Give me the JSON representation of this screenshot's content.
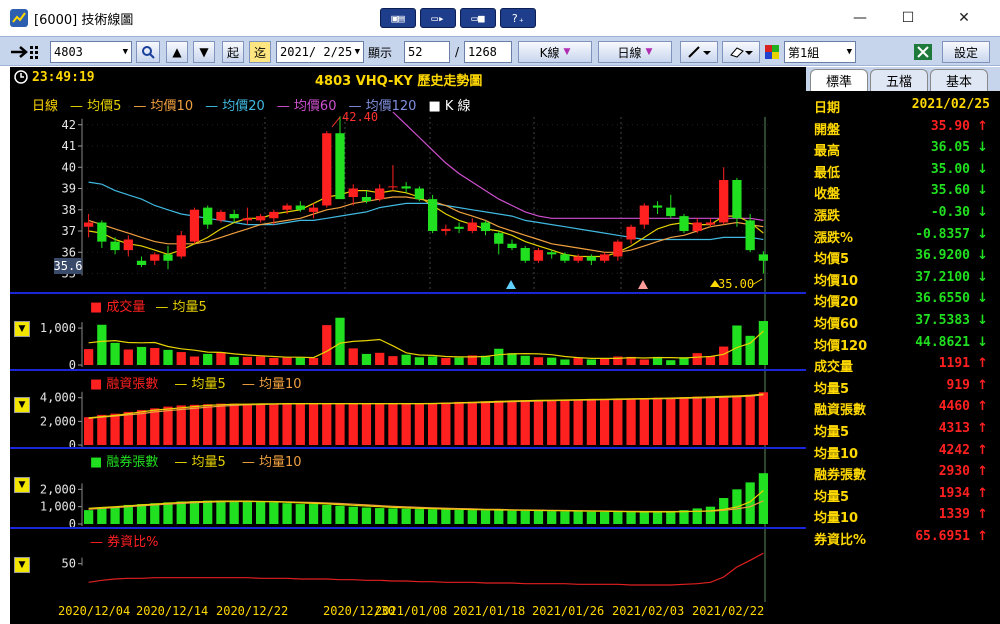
{
  "window": {
    "title": "[6000] 技術線圖",
    "minimize": "—",
    "maximize": "☐",
    "close": "✕"
  },
  "title_buttons": [
    "▣▤",
    "▭▸",
    "▭■",
    "?₊"
  ],
  "toolbar": {
    "stock_code": "4803",
    "btn_start": "起",
    "btn_end": "迄",
    "date": "2021/ 2/25",
    "show_label": "顯示",
    "show_count": "52",
    "separator": "/",
    "total": "1268",
    "k_type": "K線",
    "period": "日線",
    "group": "第1組",
    "settings": "設定"
  },
  "header": {
    "clock": "23:49:19",
    "stock_title": "4803 VHQ-KY  歷史走勢圖"
  },
  "colors": {
    "ma5": "#e6d200",
    "ma10": "#f0a040",
    "ma20": "#40b8e0",
    "ma60": "#d050d0",
    "ma120": "#4a5ab8",
    "up": "#ff2020",
    "down": "#20e020",
    "sep": "#1a27d6"
  },
  "price_panel": {
    "legend": [
      {
        "label": "日線",
        "color": "#ffd800"
      },
      {
        "label": "— 均價5",
        "color": "#e6d200"
      },
      {
        "label": "— 均價10",
        "color": "#f0a040"
      },
      {
        "label": "— 均價20",
        "color": "#40b8e0"
      },
      {
        "label": "— 均價60",
        "color": "#d050d0"
      },
      {
        "label": "— 均價120",
        "color": "#8090e0"
      },
      {
        "label": "■ K 線",
        "color": "#ffffff"
      }
    ],
    "high_label": "42.40",
    "low_label": "35.00",
    "current_label": "35.6"
  },
  "volume_panel": {
    "legend": [
      {
        "label": "■ 成交量",
        "color": "#ff2020"
      },
      {
        "label": "— 均量5",
        "color": "#e6d200"
      }
    ]
  },
  "margin_panel": {
    "legend": [
      {
        "label": "■ 融資張數",
        "color": "#ff2020"
      },
      {
        "label": "— 均量5",
        "color": "#e6d200"
      },
      {
        "label": "— 均量10",
        "color": "#f0a040"
      }
    ]
  },
  "short_panel": {
    "legend": [
      {
        "label": "■ 融券張數",
        "color": "#20e020"
      },
      {
        "label": "— 均量5",
        "color": "#e6d200"
      },
      {
        "label": "— 均量10",
        "color": "#f0a040"
      }
    ]
  },
  "ratio_panel": {
    "legend": [
      {
        "label": "— 券資比%",
        "color": "#ff2020"
      }
    ]
  },
  "dates": [
    "2020/12/04",
    "2020/12/14",
    "2020/12/22",
    "2020/12/30",
    "2021/01/08",
    "2021/01/18",
    "2021/01/26",
    "2021/02/03",
    "2021/02/22"
  ],
  "side": {
    "tabs": [
      "標準",
      "五檔",
      "基本"
    ],
    "rows": [
      {
        "k": "日期",
        "v": "2021/02/25",
        "vc": "#ffd800",
        "a": "",
        "ac": ""
      },
      {
        "k": "開盤",
        "v": "35.90",
        "vc": "#ff2020",
        "a": "↑",
        "ac": "#ff2020"
      },
      {
        "k": "最高",
        "v": "36.05",
        "vc": "#20e020",
        "a": "↓",
        "ac": "#20e020"
      },
      {
        "k": "最低",
        "v": "35.00",
        "vc": "#20e020",
        "a": "↓",
        "ac": "#20e020"
      },
      {
        "k": "收盤",
        "v": "35.60",
        "vc": "#20e020",
        "a": "↓",
        "ac": "#20e020"
      },
      {
        "k": "漲跌",
        "v": "-0.30",
        "vc": "#20e020",
        "a": "↓",
        "ac": "#20e020"
      },
      {
        "k": "漲跌%",
        "v": "-0.8357",
        "vc": "#20e020",
        "a": "↓",
        "ac": "#20e020"
      },
      {
        "k": "均價5",
        "v": "36.9200",
        "vc": "#20e020",
        "a": "↓",
        "ac": "#20e020"
      },
      {
        "k": "均價10",
        "v": "37.2100",
        "vc": "#20e020",
        "a": "↓",
        "ac": "#20e020"
      },
      {
        "k": "均價20",
        "v": "36.6550",
        "vc": "#20e020",
        "a": "↓",
        "ac": "#20e020"
      },
      {
        "k": "均價60",
        "v": "37.5383",
        "vc": "#20e020",
        "a": "↓",
        "ac": "#20e020"
      },
      {
        "k": "均價120",
        "v": "44.8621",
        "vc": "#20e020",
        "a": "↓",
        "ac": "#20e020"
      },
      {
        "k": "成交量",
        "v": "1191",
        "vc": "#ff2020",
        "a": "↑",
        "ac": "#ff2020"
      },
      {
        "k": "均量5",
        "v": "919",
        "vc": "#ff2020",
        "a": "↑",
        "ac": "#ff2020"
      },
      {
        "k": "融資張數",
        "v": "4460",
        "vc": "#ff2020",
        "a": "↑",
        "ac": "#ff2020"
      },
      {
        "k": "均量5",
        "v": "4313",
        "vc": "#ff2020",
        "a": "↑",
        "ac": "#ff2020"
      },
      {
        "k": "均量10",
        "v": "4242",
        "vc": "#ff2020",
        "a": "↑",
        "ac": "#ff2020"
      },
      {
        "k": "融券張數",
        "v": "2930",
        "vc": "#ff2020",
        "a": "↑",
        "ac": "#ff2020"
      },
      {
        "k": "均量5",
        "v": "1934",
        "vc": "#ff2020",
        "a": "↑",
        "ac": "#ff2020"
      },
      {
        "k": "均量10",
        "v": "1339",
        "vc": "#ff2020",
        "a": "↑",
        "ac": "#ff2020"
      },
      {
        "k": "券資比%",
        "v": "65.6951",
        "vc": "#ff2020",
        "a": "↑",
        "ac": "#ff2020"
      }
    ]
  },
  "chart_data": [
    {
      "type": "candlestick",
      "title": "4803 VHQ-KY 歷史走勢圖",
      "ylim": [
        34.6,
        42.6
      ],
      "yticks": [
        35,
        36,
        37,
        38,
        39,
        40,
        41,
        42
      ],
      "candles": [
        [
          37.2,
          37.8,
          36.7,
          37.4
        ],
        [
          37.4,
          37.5,
          36.2,
          36.5
        ],
        [
          36.5,
          36.7,
          35.9,
          36.1
        ],
        [
          36.1,
          36.8,
          35.8,
          36.6
        ],
        [
          35.6,
          35.8,
          35.3,
          35.4
        ],
        [
          35.6,
          36.0,
          35.4,
          35.9
        ],
        [
          35.9,
          36.3,
          35.2,
          35.6
        ],
        [
          35.8,
          37.0,
          35.7,
          36.8
        ],
        [
          36.5,
          38.1,
          36.4,
          38.0
        ],
        [
          38.1,
          38.2,
          37.1,
          37.3
        ],
        [
          37.5,
          38.0,
          37.4,
          37.9
        ],
        [
          37.8,
          38.0,
          37.4,
          37.6
        ],
        [
          37.5,
          38.1,
          37.3,
          37.6
        ],
        [
          37.5,
          37.8,
          37.4,
          37.7
        ],
        [
          37.6,
          38.0,
          37.3,
          37.9
        ],
        [
          38.0,
          38.3,
          37.8,
          38.2
        ],
        [
          38.2,
          38.4,
          37.9,
          38.0
        ],
        [
          37.9,
          38.3,
          37.6,
          38.1
        ],
        [
          38.2,
          41.7,
          38.1,
          41.6
        ],
        [
          41.6,
          42.4,
          40.2,
          38.5
        ],
        [
          38.6,
          39.2,
          38.2,
          39.0
        ],
        [
          38.6,
          38.9,
          38.3,
          38.4
        ],
        [
          38.5,
          39.2,
          38.4,
          39.0
        ],
        [
          39.1,
          40.1,
          38.9,
          39.1
        ],
        [
          39.1,
          39.3,
          38.8,
          39.0
        ],
        [
          39.0,
          39.1,
          38.4,
          38.5
        ],
        [
          38.5,
          38.7,
          36.9,
          37.0
        ],
        [
          37.0,
          37.3,
          36.8,
          37.1
        ],
        [
          37.2,
          37.4,
          36.9,
          37.1
        ],
        [
          37.0,
          37.6,
          36.9,
          37.4
        ],
        [
          37.4,
          37.5,
          36.8,
          37.0
        ],
        [
          36.9,
          37.0,
          35.9,
          36.4
        ],
        [
          36.4,
          36.6,
          36.1,
          36.2
        ],
        [
          36.2,
          36.3,
          35.5,
          35.6
        ],
        [
          35.6,
          36.2,
          35.5,
          36.1
        ],
        [
          36.0,
          36.1,
          35.7,
          35.9
        ],
        [
          35.9,
          36.0,
          35.5,
          35.6
        ],
        [
          35.6,
          35.9,
          35.5,
          35.8
        ],
        [
          35.8,
          35.9,
          35.4,
          35.6
        ],
        [
          35.6,
          36.0,
          35.5,
          35.9
        ],
        [
          35.8,
          36.6,
          35.6,
          36.5
        ],
        [
          36.6,
          37.3,
          36.4,
          37.2
        ],
        [
          37.3,
          38.3,
          37.1,
          38.2
        ],
        [
          38.2,
          38.4,
          37.8,
          38.1
        ],
        [
          38.1,
          38.7,
          37.6,
          37.7
        ],
        [
          37.7,
          37.8,
          36.9,
          37.0
        ],
        [
          37.0,
          37.6,
          36.9,
          37.4
        ],
        [
          37.3,
          37.6,
          37.2,
          37.4
        ],
        [
          37.4,
          40.0,
          37.3,
          39.4
        ],
        [
          39.4,
          39.5,
          37.2,
          37.6
        ],
        [
          37.5,
          37.8,
          36.0,
          36.1
        ],
        [
          35.9,
          36.05,
          35.0,
          35.6
        ]
      ],
      "ma5": [
        37.0,
        36.9,
        36.6,
        36.4,
        36.3,
        36.1,
        35.9,
        36.1,
        36.4,
        36.7,
        37.1,
        37.4,
        37.6,
        37.6,
        37.8,
        37.9,
        38.0,
        38.3,
        38.6,
        38.7,
        38.9,
        38.9,
        38.8,
        38.9,
        38.8,
        38.6,
        38.2,
        37.8,
        37.5,
        37.3,
        37.1,
        37.0,
        36.8,
        36.5,
        36.3,
        36.1,
        35.9,
        35.8,
        35.8,
        35.8,
        36.0,
        36.3,
        36.7,
        37.1,
        37.3,
        37.4,
        37.3,
        37.3,
        37.7,
        37.7,
        37.4,
        36.9
      ],
      "ma10": [
        37.5,
        37.3,
        37.1,
        36.9,
        36.7,
        36.5,
        36.4,
        36.4,
        36.4,
        36.5,
        36.7,
        36.9,
        37.1,
        37.3,
        37.4,
        37.5,
        37.6,
        37.8,
        38.0,
        38.1,
        38.3,
        38.4,
        38.5,
        38.6,
        38.6,
        38.5,
        38.4,
        38.2,
        37.9,
        37.7,
        37.5,
        37.2,
        37.0,
        36.8,
        36.6,
        36.4,
        36.3,
        36.2,
        36.1,
        36.0,
        36.0,
        36.1,
        36.3,
        36.5,
        36.7,
        36.8,
        37.0,
        37.2,
        37.3,
        37.4,
        37.3,
        37.2
      ],
      "ma20": [
        39.3,
        39.2,
        38.9,
        38.7,
        38.5,
        38.2,
        38.0,
        37.8,
        37.7,
        37.6,
        37.5,
        37.4,
        37.3,
        37.3,
        37.3,
        37.4,
        37.5,
        37.5,
        37.6,
        37.7,
        37.8,
        37.9,
        38.1,
        38.2,
        38.3,
        38.3,
        38.3,
        38.2,
        38.1,
        38.0,
        37.9,
        37.8,
        37.7,
        37.5,
        37.4,
        37.3,
        37.2,
        37.1,
        37.0,
        36.9,
        36.8,
        36.7,
        36.6,
        36.6,
        36.6,
        36.6,
        36.6,
        36.6,
        36.7,
        36.7,
        36.7,
        36.6
      ],
      "ma60": [
        null,
        null,
        null,
        null,
        null,
        null,
        null,
        null,
        null,
        null,
        null,
        null,
        null,
        null,
        null,
        null,
        null,
        null,
        null,
        null,
        null,
        null,
        null,
        42.6,
        42.0,
        41.4,
        40.8,
        40.2,
        39.7,
        39.3,
        38.9,
        38.5,
        38.2,
        37.9,
        37.7,
        37.6,
        37.6,
        37.6,
        37.6,
        37.6,
        37.6,
        37.6,
        37.6,
        37.6,
        37.6,
        37.6,
        37.6,
        37.6,
        37.6,
        37.6,
        37.6,
        37.5
      ]
    },
    {
      "type": "bar",
      "title": "成交量",
      "ylim": [
        0,
        1300
      ],
      "yticks": [
        0,
        1000
      ],
      "values": [
        430,
        1090,
        600,
        420,
        490,
        460,
        410,
        350,
        230,
        300,
        350,
        220,
        220,
        230,
        190,
        200,
        200,
        190,
        1080,
        1280,
        450,
        300,
        330,
        240,
        280,
        210,
        230,
        190,
        200,
        260,
        250,
        440,
        320,
        250,
        210,
        200,
        150,
        200,
        150,
        180,
        230,
        220,
        150,
        220,
        130,
        210,
        320,
        240,
        500,
        1070,
        790,
        1191
      ],
      "ma5": [
        600,
        640,
        660,
        610,
        600,
        610,
        500,
        440,
        400,
        350,
        340,
        300,
        270,
        250,
        230,
        210,
        210,
        200,
        370,
        590,
        640,
        660,
        690,
        520,
        330,
        270,
        260,
        230,
        220,
        220,
        230,
        280,
        300,
        310,
        300,
        280,
        230,
        200,
        180,
        180,
        180,
        200,
        190,
        200,
        200,
        190,
        210,
        230,
        290,
        470,
        590,
        919
      ]
    },
    {
      "type": "bar",
      "title": "融資張數",
      "ylim": [
        0,
        4400
      ],
      "yticks": [
        0,
        2000,
        4000
      ],
      "values": [
        2350,
        2550,
        2650,
        2800,
        2950,
        3100,
        3250,
        3350,
        3400,
        3450,
        3500,
        3500,
        3500,
        3500,
        3500,
        3500,
        3500,
        3500,
        3500,
        3500,
        3500,
        3500,
        3500,
        3500,
        3500,
        3500,
        3550,
        3600,
        3650,
        3650,
        3700,
        3750,
        3750,
        3800,
        3800,
        3800,
        3850,
        3850,
        3900,
        3900,
        3900,
        3950,
        3950,
        4000,
        4000,
        4050,
        4100,
        4100,
        4150,
        4200,
        4250,
        4460
      ],
      "ma5": [
        2300,
        2400,
        2500,
        2650,
        2800,
        2950,
        3050,
        3150,
        3250,
        3350,
        3400,
        3450,
        3450,
        3480,
        3490,
        3500,
        3500,
        3500,
        3500,
        3500,
        3500,
        3500,
        3500,
        3500,
        3500,
        3500,
        3510,
        3540,
        3580,
        3610,
        3650,
        3680,
        3720,
        3750,
        3770,
        3790,
        3810,
        3830,
        3850,
        3870,
        3890,
        3910,
        3930,
        3950,
        3970,
        4000,
        4040,
        4070,
        4110,
        4150,
        4200,
        4313
      ],
      "ma10": [
        2250,
        2350,
        2450,
        2550,
        2650,
        2800,
        2900,
        3000,
        3100,
        3200,
        3280,
        3350,
        3400,
        3430,
        3460,
        3480,
        3490,
        3500,
        3500,
        3500,
        3500,
        3500,
        3500,
        3500,
        3500,
        3500,
        3500,
        3520,
        3540,
        3570,
        3600,
        3630,
        3660,
        3690,
        3720,
        3750,
        3770,
        3790,
        3810,
        3830,
        3850,
        3870,
        3890,
        3910,
        3930,
        3950,
        3980,
        4010,
        4040,
        4080,
        4130,
        4242
      ]
    },
    {
      "type": "bar",
      "title": "融券張數",
      "ylim": [
        0,
        3000
      ],
      "yticks": [
        0,
        1000,
        2000
      ],
      "values": [
        800,
        900,
        1000,
        1100,
        1150,
        1200,
        1250,
        1300,
        1320,
        1350,
        1350,
        1320,
        1300,
        1280,
        1250,
        1200,
        1150,
        1150,
        1100,
        1050,
        1000,
        950,
        920,
        900,
        880,
        860,
        850,
        830,
        810,
        800,
        790,
        780,
        770,
        760,
        750,
        740,
        730,
        720,
        710,
        700,
        700,
        690,
        690,
        700,
        720,
        800,
        900,
        1000,
        1500,
        2000,
        2400,
        2930
      ],
      "ma5": [
        900,
        950,
        1000,
        1050,
        1100,
        1150,
        1200,
        1250,
        1280,
        1300,
        1320,
        1320,
        1320,
        1300,
        1280,
        1250,
        1220,
        1190,
        1160,
        1120,
        1080,
        1040,
        1000,
        960,
        930,
        900,
        880,
        860,
        850,
        830,
        820,
        810,
        800,
        790,
        780,
        770,
        760,
        750,
        740,
        730,
        720,
        710,
        700,
        700,
        700,
        710,
        730,
        760,
        840,
        980,
        1280,
        1934
      ],
      "ma10": [
        850,
        900,
        950,
        1000,
        1050,
        1100,
        1150,
        1190,
        1230,
        1260,
        1280,
        1300,
        1300,
        1300,
        1300,
        1280,
        1260,
        1240,
        1210,
        1180,
        1140,
        1100,
        1060,
        1020,
        990,
        960,
        930,
        910,
        890,
        870,
        850,
        840,
        820,
        810,
        800,
        790,
        780,
        770,
        760,
        750,
        740,
        730,
        720,
        720,
        720,
        720,
        730,
        740,
        790,
        870,
        1000,
        1339
      ]
    },
    {
      "type": "line",
      "title": "券資比%",
      "ylim": [
        0,
        75
      ],
      "yticks": [
        50
      ],
      "values": [
        22,
        25,
        27,
        28,
        28,
        29,
        29,
        29,
        29,
        29,
        29,
        29,
        29,
        28,
        28,
        28,
        27,
        27,
        27,
        26,
        26,
        25,
        25,
        24,
        24,
        23,
        23,
        22,
        22,
        22,
        21,
        21,
        21,
        20,
        20,
        20,
        20,
        19,
        19,
        19,
        19,
        18,
        18,
        18,
        18,
        19,
        20,
        22,
        30,
        45,
        55,
        65.7
      ]
    }
  ]
}
